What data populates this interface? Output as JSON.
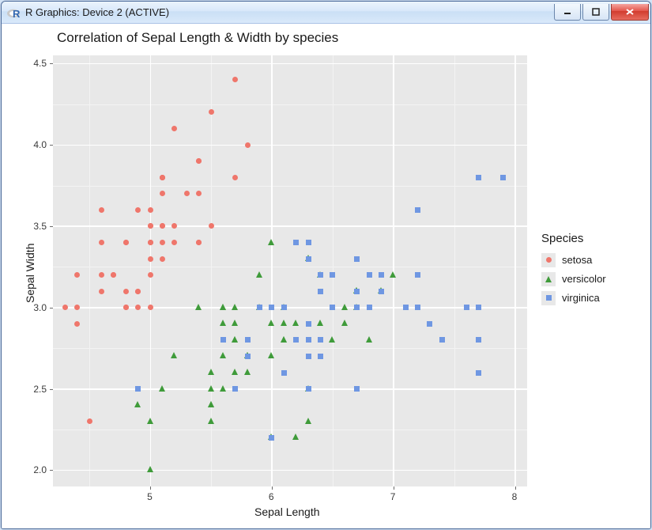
{
  "window": {
    "title": "R Graphics: Device 2 (ACTIVE)"
  },
  "chart_data": {
    "type": "scatter",
    "title": "Correlation of Sepal Length & Width by species",
    "xlabel": "Sepal Length",
    "ylabel": "Sepal Width",
    "xlim": [
      4.2,
      8.1
    ],
    "ylim": [
      1.9,
      4.55
    ],
    "x_major_ticks": [
      5,
      6,
      7,
      8
    ],
    "y_major_ticks": [
      2.0,
      2.5,
      3.0,
      3.5,
      4.0,
      4.5
    ],
    "x_minor_ticks": [
      4.5,
      5.5,
      6.5,
      7.5
    ],
    "y_minor_ticks": [
      2.25,
      2.75,
      3.25,
      3.75,
      4.25
    ],
    "legend": {
      "title": "Species"
    },
    "series": [
      {
        "name": "setosa",
        "color": "#ef766b",
        "shape": "circle",
        "points": [
          [
            5.1,
            3.5
          ],
          [
            4.9,
            3.0
          ],
          [
            4.7,
            3.2
          ],
          [
            4.6,
            3.1
          ],
          [
            5.0,
            3.6
          ],
          [
            5.4,
            3.9
          ],
          [
            4.6,
            3.4
          ],
          [
            5.0,
            3.4
          ],
          [
            4.4,
            2.9
          ],
          [
            4.9,
            3.1
          ],
          [
            5.4,
            3.7
          ],
          [
            4.8,
            3.4
          ],
          [
            4.8,
            3.0
          ],
          [
            4.3,
            3.0
          ],
          [
            5.8,
            4.0
          ],
          [
            5.7,
            4.4
          ],
          [
            5.4,
            3.9
          ],
          [
            5.1,
            3.5
          ],
          [
            5.7,
            3.8
          ],
          [
            5.1,
            3.8
          ],
          [
            5.4,
            3.4
          ],
          [
            5.1,
            3.7
          ],
          [
            4.6,
            3.6
          ],
          [
            5.1,
            3.3
          ],
          [
            4.8,
            3.4
          ],
          [
            5.0,
            3.0
          ],
          [
            5.0,
            3.4
          ],
          [
            5.2,
            3.5
          ],
          [
            5.2,
            3.4
          ],
          [
            4.7,
            3.2
          ],
          [
            4.8,
            3.1
          ],
          [
            5.4,
            3.4
          ],
          [
            5.2,
            4.1
          ],
          [
            5.5,
            4.2
          ],
          [
            4.9,
            3.1
          ],
          [
            5.0,
            3.2
          ],
          [
            5.5,
            3.5
          ],
          [
            4.9,
            3.6
          ],
          [
            4.4,
            3.0
          ],
          [
            5.1,
            3.4
          ],
          [
            5.0,
            3.5
          ],
          [
            4.5,
            2.3
          ],
          [
            4.4,
            3.2
          ],
          [
            5.0,
            3.5
          ],
          [
            5.1,
            3.8
          ],
          [
            4.8,
            3.0
          ],
          [
            5.1,
            3.8
          ],
          [
            4.6,
            3.2
          ],
          [
            5.3,
            3.7
          ],
          [
            5.0,
            3.3
          ]
        ]
      },
      {
        "name": "versicolor",
        "color": "#3f9b3a",
        "shape": "triangle",
        "points": [
          [
            7.0,
            3.2
          ],
          [
            6.4,
            3.2
          ],
          [
            6.9,
            3.1
          ],
          [
            5.5,
            2.3
          ],
          [
            6.5,
            2.8
          ],
          [
            5.7,
            2.8
          ],
          [
            6.3,
            3.3
          ],
          [
            4.9,
            2.4
          ],
          [
            6.6,
            2.9
          ],
          [
            5.2,
            2.7
          ],
          [
            5.0,
            2.0
          ],
          [
            5.9,
            3.0
          ],
          [
            6.0,
            2.2
          ],
          [
            6.1,
            2.9
          ],
          [
            5.6,
            2.9
          ],
          [
            6.7,
            3.1
          ],
          [
            5.6,
            3.0
          ],
          [
            5.8,
            2.7
          ],
          [
            6.2,
            2.2
          ],
          [
            5.6,
            2.5
          ],
          [
            5.9,
            3.2
          ],
          [
            6.1,
            2.8
          ],
          [
            6.3,
            2.5
          ],
          [
            6.1,
            2.8
          ],
          [
            6.4,
            2.9
          ],
          [
            6.6,
            3.0
          ],
          [
            6.8,
            2.8
          ],
          [
            6.7,
            3.0
          ],
          [
            6.0,
            2.9
          ],
          [
            5.7,
            2.6
          ],
          [
            5.5,
            2.4
          ],
          [
            5.5,
            2.4
          ],
          [
            5.8,
            2.7
          ],
          [
            6.0,
            2.7
          ],
          [
            5.4,
            3.0
          ],
          [
            6.0,
            3.4
          ],
          [
            6.7,
            3.1
          ],
          [
            6.3,
            2.3
          ],
          [
            5.6,
            3.0
          ],
          [
            5.5,
            2.5
          ],
          [
            5.5,
            2.6
          ],
          [
            6.1,
            3.0
          ],
          [
            5.8,
            2.6
          ],
          [
            5.0,
            2.3
          ],
          [
            5.6,
            2.7
          ],
          [
            5.7,
            3.0
          ],
          [
            5.7,
            2.9
          ],
          [
            6.2,
            2.9
          ],
          [
            5.1,
            2.5
          ],
          [
            5.7,
            2.8
          ]
        ]
      },
      {
        "name": "virginica",
        "color": "#6f97e2",
        "shape": "square",
        "points": [
          [
            6.3,
            3.3
          ],
          [
            5.8,
            2.7
          ],
          [
            7.1,
            3.0
          ],
          [
            6.3,
            2.9
          ],
          [
            6.5,
            3.0
          ],
          [
            7.6,
            3.0
          ],
          [
            4.9,
            2.5
          ],
          [
            7.3,
            2.9
          ],
          [
            6.7,
            2.5
          ],
          [
            7.2,
            3.6
          ],
          [
            6.5,
            3.2
          ],
          [
            6.4,
            2.7
          ],
          [
            6.8,
            3.0
          ],
          [
            5.7,
            2.5
          ],
          [
            5.8,
            2.8
          ],
          [
            6.4,
            3.2
          ],
          [
            6.5,
            3.0
          ],
          [
            7.7,
            3.8
          ],
          [
            7.7,
            2.6
          ],
          [
            6.0,
            2.2
          ],
          [
            6.9,
            3.2
          ],
          [
            5.6,
            2.8
          ],
          [
            7.7,
            2.8
          ],
          [
            6.3,
            2.7
          ],
          [
            6.7,
            3.3
          ],
          [
            7.2,
            3.2
          ],
          [
            6.2,
            2.8
          ],
          [
            6.1,
            3.0
          ],
          [
            6.4,
            2.8
          ],
          [
            7.2,
            3.0
          ],
          [
            7.4,
            2.8
          ],
          [
            7.9,
            3.8
          ],
          [
            6.4,
            2.8
          ],
          [
            6.3,
            2.8
          ],
          [
            6.1,
            2.6
          ],
          [
            7.7,
            3.0
          ],
          [
            6.3,
            3.4
          ],
          [
            6.4,
            3.1
          ],
          [
            6.0,
            3.0
          ],
          [
            6.9,
            3.1
          ],
          [
            6.7,
            3.1
          ],
          [
            6.9,
            3.1
          ],
          [
            5.8,
            2.7
          ],
          [
            6.8,
            3.2
          ],
          [
            6.7,
            3.3
          ],
          [
            6.7,
            3.0
          ],
          [
            6.3,
            2.5
          ],
          [
            6.5,
            3.0
          ],
          [
            6.2,
            3.4
          ],
          [
            5.9,
            3.0
          ]
        ]
      }
    ]
  }
}
